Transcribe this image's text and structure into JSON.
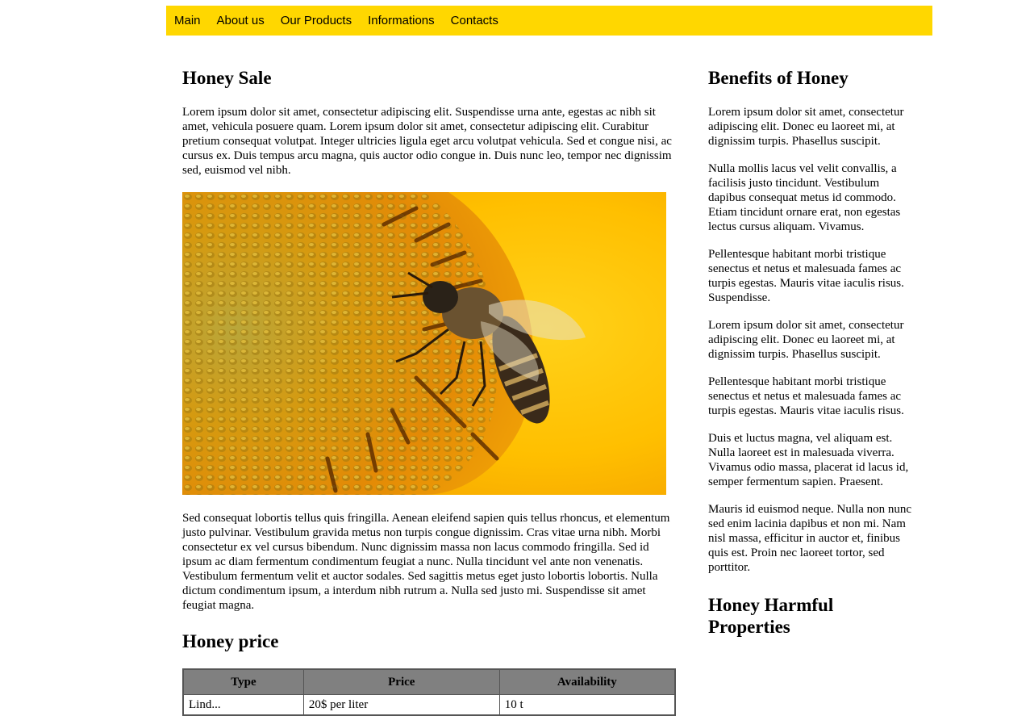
{
  "nav": {
    "items": [
      "Main",
      "About us",
      "Our Products",
      "Informations",
      "Contacts"
    ]
  },
  "main": {
    "title": "Honey Sale",
    "intro": "Lorem ipsum dolor sit amet, consectetur adipiscing elit. Suspendisse urna ante, egestas ac nibh sit amet, vehicula posuere quam. Lorem ipsum dolor sit amet, consectetur adipiscing elit. Curabitur pretium consequat volutpat. Integer ultricies ligula eget arcu volutpat vehicula. Sed et congue nisi, ac cursus ex. Duis tempus arcu magna, quis auctor odio congue in. Duis nunc leo, tempor nec dignissim sed, euismod vel nibh.",
    "body": "Sed consequat lobortis tellus quis fringilla. Aenean eleifend sapien quis tellus rhoncus, et elementum justo pulvinar. Vestibulum gravida metus non turpis congue dignissim. Cras vitae urna nibh. Morbi consectetur ex vel cursus bibendum. Nunc dignissim massa non lacus commodo fringilla. Sed id ipsum ac diam fermentum condimentum feugiat a nunc. Nulla tincidunt vel ante non venenatis. Vestibulum fermentum velit et auctor sodales. Sed sagittis metus eget justo lobortis lobortis. Nulla dictum condimentum ipsum, a interdum nibh rutrum a. Nulla sed justo mi. Suspendisse sit amet feugiat magna.",
    "price_title": "Honey price",
    "table": {
      "headers": [
        "Type",
        "Price",
        "Availability"
      ],
      "rows": [
        [
          "Lind...",
          "20$ per liter",
          "10 t"
        ]
      ]
    }
  },
  "side": {
    "title": "Benefits of Honey",
    "paragraphs": [
      "Lorem ipsum dolor sit amet, consectetur adipiscing elit. Donec eu laoreet mi, at dignissim turpis. Phasellus suscipit.",
      "Nulla mollis lacus vel velit convallis, a facilisis justo tincidunt. Vestibulum dapibus consequat metus id commodo. Etiam tincidunt ornare erat, non egestas lectus cursus aliquam. Vivamus.",
      "Pellentesque habitant morbi tristique senectus et netus et malesuada fames ac turpis egestas. Mauris vitae iaculis risus. Suspendisse.",
      "Lorem ipsum dolor sit amet, consectetur adipiscing elit. Donec eu laoreet mi, at dignissim turpis. Phasellus suscipit.",
      "Pellentesque habitant morbi tristique senectus et netus et malesuada fames ac turpis egestas. Mauris vitae iaculis risus.",
      "Duis et luctus magna, vel aliquam est. Nulla laoreet est in malesuada viverra. Vivamus odio massa, placerat id lacus id, semper fermentum sapien. Praesent.",
      "Mauris id euismod neque. Nulla non nunc sed enim lacinia dapibus et non mi. Nam nisl massa, efficitur in auctor et, finibus quis est. Proin nec laoreet tortor, sed porttitor."
    ],
    "harm_title": "Honey Harmful Properties"
  },
  "colors": {
    "nav_bg": "#ffd700",
    "table_header_bg": "#808080"
  }
}
